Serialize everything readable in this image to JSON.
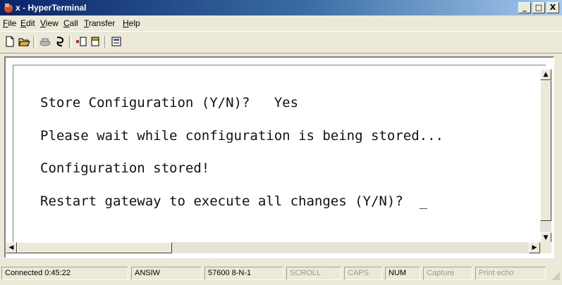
{
  "window": {
    "title": "x - HyperTerminal",
    "controls": {
      "minimize": "_",
      "maximize": "□",
      "close": "X"
    }
  },
  "menu": {
    "items": [
      {
        "key": "F",
        "rest": "ile"
      },
      {
        "key": "E",
        "rest": "dit"
      },
      {
        "key": "V",
        "rest": "iew"
      },
      {
        "key": "C",
        "rest": "all"
      },
      {
        "key": "T",
        "rest": "ransfer"
      },
      {
        "key": "H",
        "rest": "elp"
      }
    ]
  },
  "toolbar": {
    "buttons": [
      "new-icon",
      "open-icon",
      "phone-icon",
      "disconnect-icon",
      "send-icon",
      "receive-icon",
      "properties-icon"
    ]
  },
  "terminal": {
    "lines": [
      "Store Configuration (Y/N)?   Yes",
      "Please wait while configuration is being stored...",
      "Configuration stored!",
      "Restart gateway to execute all changes (Y/N)?  _"
    ]
  },
  "status": {
    "connected": "Connected 0:45:22",
    "emulation": "ANSIW",
    "settings": "57600 8-N-1",
    "scroll": "SCROLL",
    "caps": "CAPS",
    "num": "NUM",
    "capture": "Capture",
    "print_echo": "Print echo"
  },
  "colors": {
    "title_start": "#0a246a",
    "title_end": "#a6caf0",
    "window_bg": "#ece9d8",
    "terminal_bg": "#ffffff"
  }
}
